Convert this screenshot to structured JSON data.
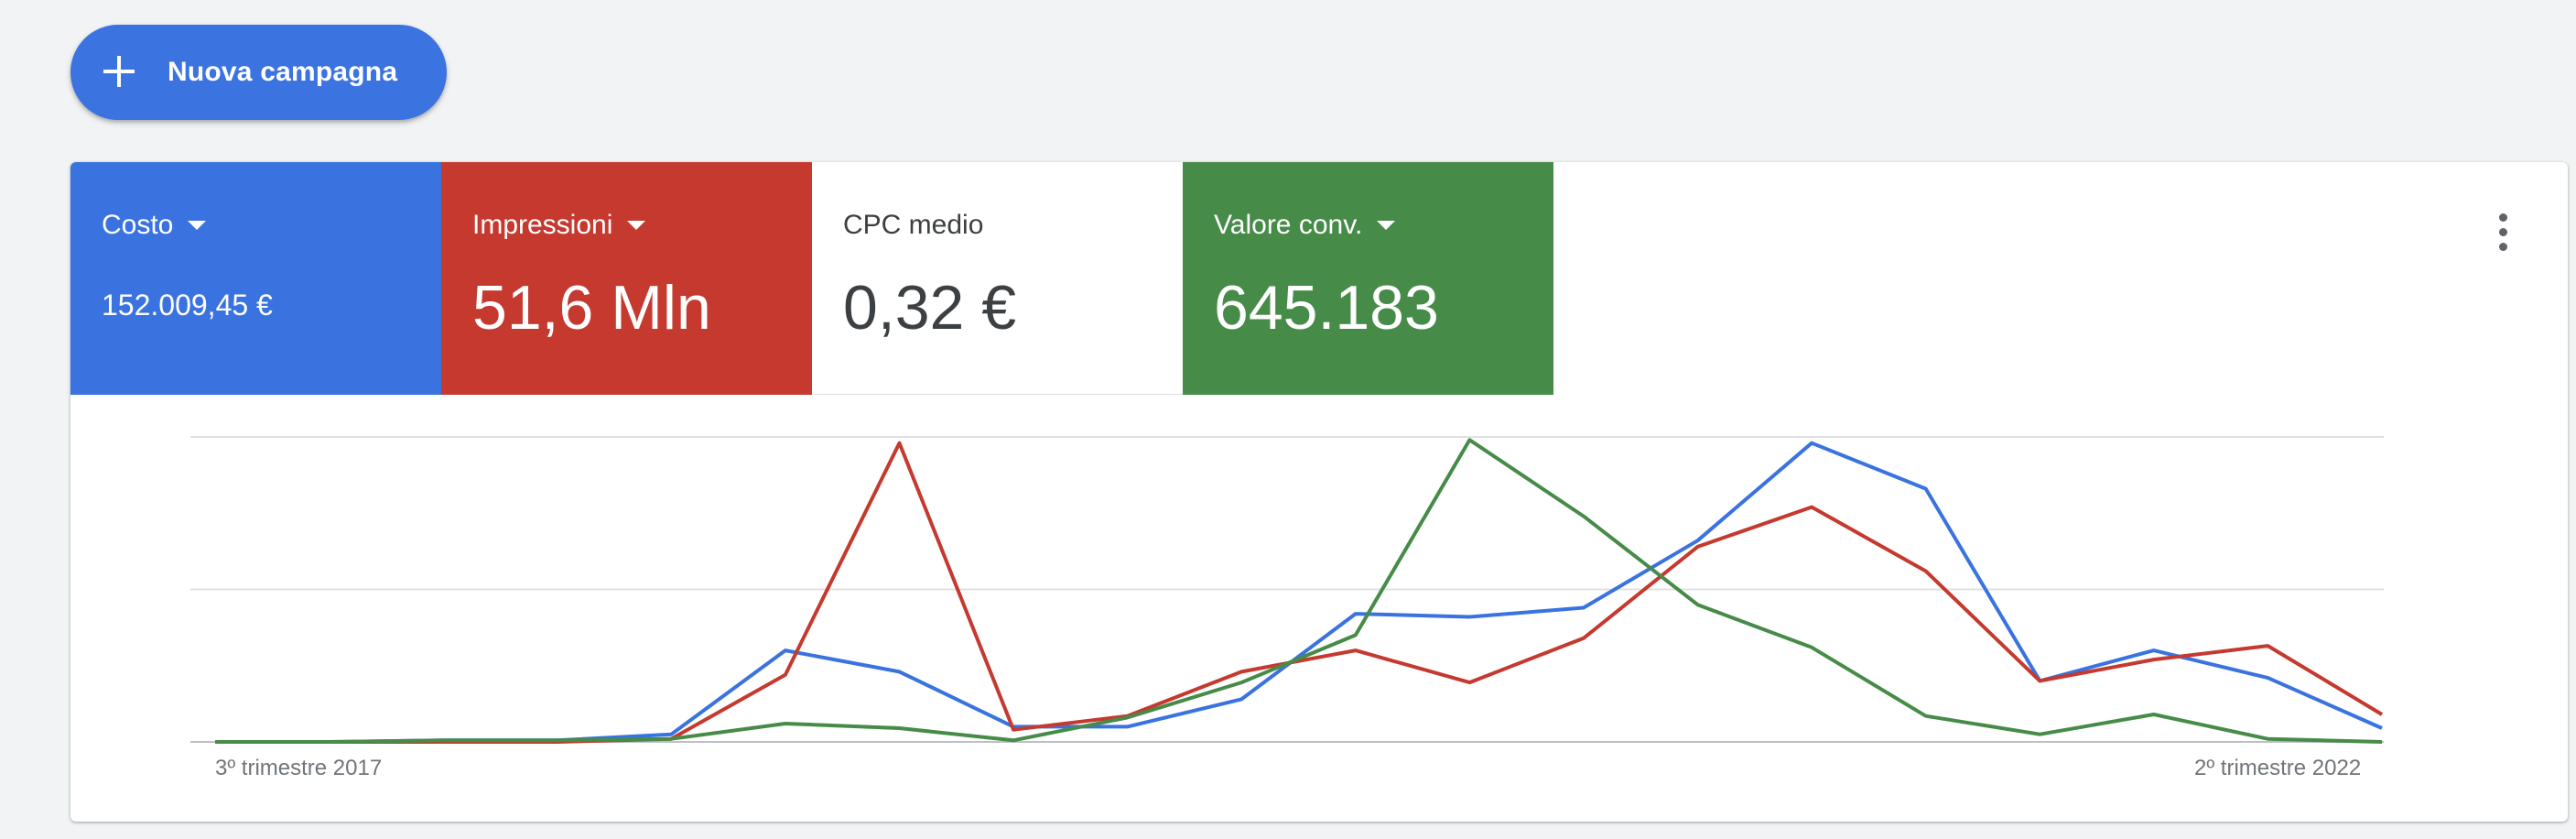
{
  "toolbar": {
    "new_campaign_label": "Nuova campagna"
  },
  "metrics": [
    {
      "label": "Costo",
      "value": "152.009,45 €",
      "color": "#3a73e0",
      "has_dropdown": true
    },
    {
      "label": "Impressioni",
      "value": "51,6 Mln",
      "color": "#c5392f",
      "has_dropdown": true
    },
    {
      "label": "CPC medio",
      "value": "0,32 €",
      "color": "#ffffff",
      "has_dropdown": false
    },
    {
      "label": "Valore conv.",
      "value": "645.183",
      "color": "#468b48",
      "has_dropdown": true
    }
  ],
  "icons": {
    "add": "plus-icon",
    "more": "more-vert-icon",
    "dropdown": "caret-down-icon"
  },
  "chart_data": {
    "type": "line",
    "x_start_label": "3º trimestre 2017",
    "x_end_label": "2º trimestre 2022",
    "grid": true,
    "ylim": [
      0,
      100
    ],
    "series": [
      {
        "color": "#3a73e0",
        "values": [
          0,
          0,
          0.5,
          0.5,
          2.5,
          30,
          23,
          5,
          5,
          14,
          42,
          41,
          44,
          66,
          98,
          83,
          20,
          30,
          21,
          4.5
        ]
      },
      {
        "color": "#c5392f",
        "values": [
          0,
          0,
          0,
          0,
          1,
          22,
          98,
          4,
          8.5,
          23,
          30,
          19.5,
          34,
          64,
          77,
          56,
          20,
          27,
          31.5,
          9
        ]
      },
      {
        "color": "#468b48",
        "values": [
          0,
          0,
          0.5,
          0.5,
          1,
          6,
          4.5,
          0.5,
          8,
          19.5,
          35,
          99,
          74,
          45,
          31,
          8.5,
          2.5,
          9,
          1,
          0
        ]
      }
    ]
  }
}
